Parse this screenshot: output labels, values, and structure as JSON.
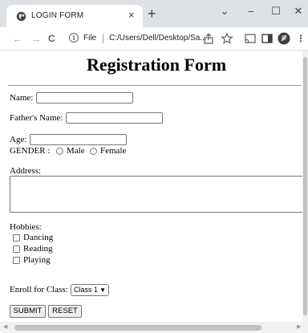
{
  "browser": {
    "tab_title": "LOGIN FORM",
    "tab_close": "×",
    "new_tab": "+",
    "window_controls": {
      "dropdown": "⌄",
      "minimize": "–",
      "maximize": "☐",
      "close": "✕"
    },
    "nav": {
      "back": "←",
      "forward": "→",
      "reload": "C"
    },
    "address_scheme": "File",
    "address_url": "C:/Users/Dell/Desktop/Sa...",
    "icons": [
      "globe-icon",
      "info-icon",
      "share-icon",
      "star-icon",
      "cast-icon",
      "sidepanel-icon",
      "profile-icon",
      "menu-icon"
    ]
  },
  "form": {
    "title": "Registration Form",
    "name_label": "Name:",
    "father_label": "Father's Name:",
    "age_label": "Age:",
    "gender_label": "GENDER :",
    "gender_options": [
      "Male",
      "Female"
    ],
    "address_label": "Address:",
    "hobbies_label": "Hobbies:",
    "hobbies": [
      "Dancing",
      "Reading",
      "Playing"
    ],
    "class_label": "Enroll for Class:",
    "class_selected": "Class 1",
    "submit_label": "SUBMIT",
    "reset_label": "RESET"
  },
  "colors": {
    "tabstrip": "#dee1e6",
    "input_border": "#767676",
    "button_bg": "#efefef"
  }
}
